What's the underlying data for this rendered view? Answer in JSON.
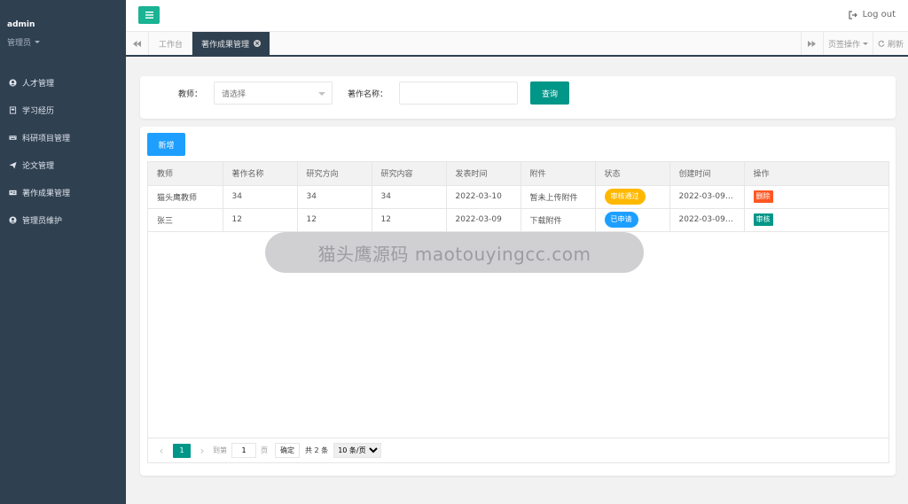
{
  "user": {
    "name": "admin",
    "role": "管理员"
  },
  "sidebar": {
    "items": [
      {
        "label": "人才管理",
        "icon": "user-circle-icon"
      },
      {
        "label": "学习经历",
        "icon": "book-icon"
      },
      {
        "label": "科研项目管理",
        "icon": "keyboard-icon"
      },
      {
        "label": "论文管理",
        "icon": "send-icon"
      },
      {
        "label": "著作成果管理",
        "icon": "id-card-icon"
      },
      {
        "label": "管理员维护",
        "icon": "user-circle-icon"
      }
    ]
  },
  "topbar": {
    "logout_label": "Log out"
  },
  "tabs": {
    "home": "工作台",
    "active": "著作成果管理",
    "page_ops": "页签操作",
    "refresh": "刷新"
  },
  "search": {
    "teacher_label": "教师：",
    "teacher_placeholder": "请选择",
    "work_name_label": "著作名称：",
    "work_name_value": "",
    "query_button": "查询"
  },
  "toolbar": {
    "add_button": "新增"
  },
  "table": {
    "columns": [
      "教师",
      "著作名称",
      "研究方向",
      "研究内容",
      "发表时间",
      "附件",
      "状态",
      "创建时间",
      "操作"
    ],
    "rows": [
      {
        "teacher": "猫头鹰教师",
        "work_name": "34",
        "direction": "34",
        "content": "34",
        "publish_date": "2022-03-10",
        "attachment": "暂未上传附件",
        "status": "审核通过",
        "created": "2022-03-09 ...",
        "action": "删除"
      },
      {
        "teacher": "张三",
        "work_name": "12",
        "direction": "12",
        "content": "12",
        "publish_date": "2022-03-09",
        "attachment": "下载附件",
        "status": "已申请",
        "created": "2022-03-09 ...",
        "action": "审核"
      }
    ]
  },
  "pager": {
    "current_page": "1",
    "goto_label": "到第",
    "goto_value": "1",
    "page_suffix": "页",
    "confirm_button": "确定",
    "total": "共 2 条",
    "page_size": "10 条/页"
  },
  "watermark": "猫头鹰源码 maotouyingcc.com",
  "colors": {
    "sidebar_bg": "#2f4050",
    "primary_green": "#009688",
    "accent_teal": "#1ab394",
    "blue": "#1e9fff",
    "status_approved": "#ffb800",
    "status_applied": "#1e9fff",
    "delete_red": "#ff5722"
  }
}
